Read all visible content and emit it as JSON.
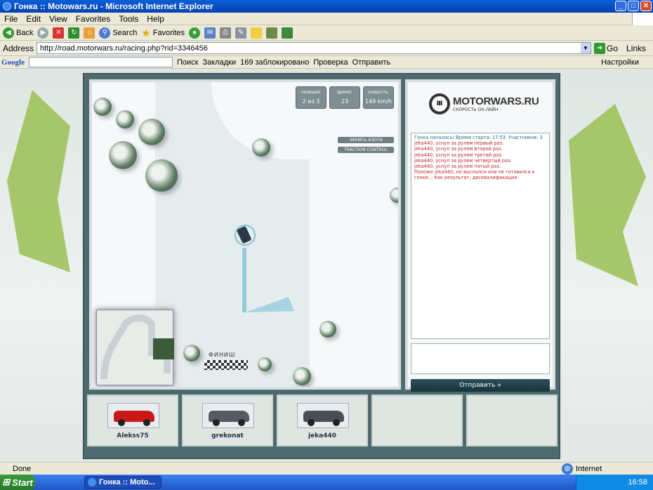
{
  "window": {
    "title": "Гонка :: Motowars.ru - Microsoft Internet Explorer"
  },
  "menu": [
    "File",
    "Edit",
    "View",
    "Favorites",
    "Tools",
    "Help"
  ],
  "toolbar": {
    "back": "Back",
    "search": "Search",
    "favorites": "Favorites"
  },
  "address": {
    "label": "Address",
    "url": "http://road.motorwars.ru/racing.php?rid=3346456",
    "go": "Go",
    "links": "Links"
  },
  "google_bar": {
    "search": "Поиск",
    "bookmarks": "Закладки",
    "blocked": "169 заблокировано",
    "check": "Проверка",
    "send": "Отправить",
    "settings": "Настройки"
  },
  "hud": {
    "position_label": "позиция:",
    "position": "2 из 3",
    "time_label": "время:",
    "time": "23",
    "speed_label": "скорость:",
    "speed": "149 km/h"
  },
  "buttons": {
    "nitro": "ЗАКИСЬ АЗОТА",
    "traction": "TRACTION CONTROL",
    "send": "Отправить »"
  },
  "finish_label": "ФИНИШ",
  "logo": {
    "name": "MOTORWARS.RU",
    "tagline": "СКОРОСТЬ ОН-ЛАЙН"
  },
  "chat": [
    {
      "type": "sys",
      "text": "Гонка началась! Время старта: 17:53. Участников: 3"
    },
    {
      "type": "err",
      "text": "jeka440, уснул за рулем первый раз."
    },
    {
      "type": "err",
      "text": "jeka440, уснул за рулем второй раз."
    },
    {
      "type": "err",
      "text": "jeka440, уснул за рулем третий раз."
    },
    {
      "type": "err",
      "text": "jeka440, уснул за рулем четвертый раз."
    },
    {
      "type": "err",
      "text": "jeka440, уснул за рулем пятый раз."
    },
    {
      "type": "err",
      "text": "Похоже jeka440, не выспался или не готовился к гонке... Как результат, дисквалификация."
    }
  ],
  "racers": [
    {
      "name": "Alekss75",
      "color": "#c81818"
    },
    {
      "name": "grekonat",
      "color": "#555b60"
    },
    {
      "name": "jeka440",
      "color": "#4a4f55"
    }
  ],
  "status": {
    "text": "Done",
    "zone": "Internet"
  },
  "taskbar": {
    "start": "Start",
    "task": "Гонка :: Moto...",
    "clock": "16:58"
  }
}
